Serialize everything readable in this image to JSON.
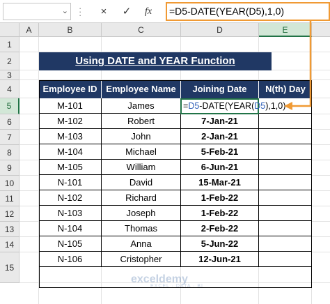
{
  "formula_bar": {
    "name_box": "",
    "cancel_icon": "×",
    "enter_icon": "✓",
    "fx_label": "fx",
    "formula": "=D5-DATE(YEAR(D5),1,0)"
  },
  "columns": [
    "A",
    "B",
    "C",
    "D",
    "E"
  ],
  "rows": [
    "1",
    "2",
    "3",
    "4",
    "5",
    "6",
    "7",
    "8",
    "9",
    "10",
    "11",
    "12",
    "13",
    "14",
    "15"
  ],
  "title": "Using DATE and YEAR Function",
  "table": {
    "headers": [
      "Employee ID",
      "Employee Name",
      "Joining Date",
      "N(th) Day"
    ],
    "rows": [
      {
        "id": "M-101",
        "name": "James",
        "date": ""
      },
      {
        "id": "M-102",
        "name": "Robert",
        "date": "7-Jan-21"
      },
      {
        "id": "M-103",
        "name": "John",
        "date": "2-Jan-21"
      },
      {
        "id": "M-104",
        "name": "Michael",
        "date": "5-Feb-21"
      },
      {
        "id": "M-105",
        "name": "William",
        "date": "6-Jun-21"
      },
      {
        "id": "N-101",
        "name": "David",
        "date": "15-Mar-21"
      },
      {
        "id": "N-102",
        "name": "Richard",
        "date": "1-Feb-22"
      },
      {
        "id": "N-103",
        "name": "Joseph",
        "date": "1-Feb-22"
      },
      {
        "id": "N-104",
        "name": "Thomas",
        "date": "2-Feb-22"
      },
      {
        "id": "N-105",
        "name": "Anna",
        "date": "5-Jun-22"
      },
      {
        "id": "N-106",
        "name": "Cristopher",
        "date": "12-Jun-21"
      }
    ]
  },
  "edit_cell": {
    "p1": "=",
    "p2": "D5",
    "p3": "-DATE(YEAR(",
    "p4": "D5",
    "p5": "),1,0)"
  },
  "watermark": {
    "brand": "exceldemy",
    "tagline": "EXCEL · DATA · BI"
  },
  "colors": {
    "header_bg": "#203864",
    "accent_orange": "#f09a34",
    "excel_green": "#217346",
    "ref_blue": "#2e5fb8"
  }
}
